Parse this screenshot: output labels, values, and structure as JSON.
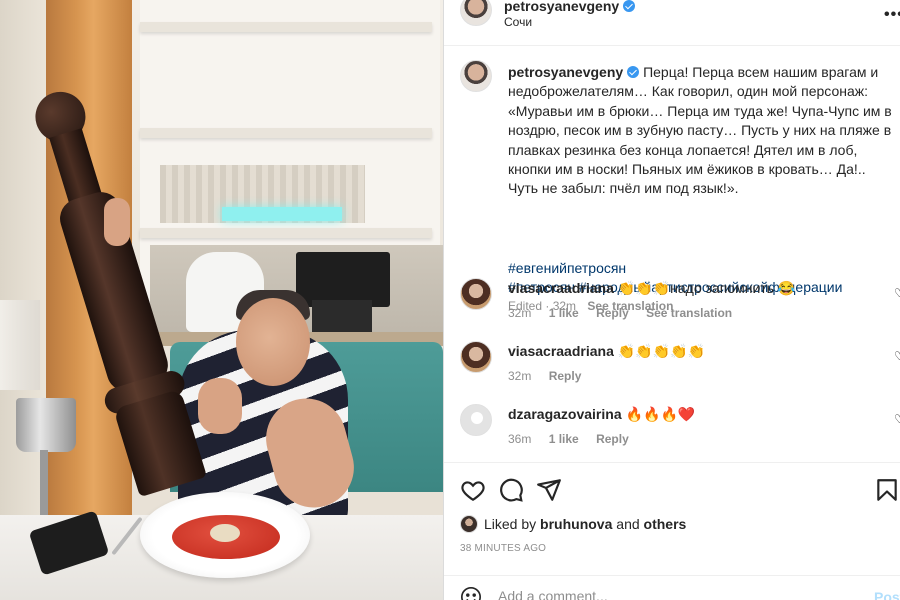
{
  "post": {
    "username": "petrosyanevgeny",
    "location": "Сочи",
    "caption_text": "Перца! Перца всем нашим врагам и недоброжелателям… Как говорил, один мой персонаж: «Муравьи им в брюки… Перца им туда же! Чупа-Чупс им в ноздрю, песок им в зубную пасту… Пусть у них на пляже в плавках резинка без конца лопается! Дятел им в лоб, кнопки им в носки! Пьяных им ёжиков в кровать… Да!.. Чуть не забыл: пчёл им под язык!».",
    "hashtags": [
      "#евгенийпетросян",
      "#петросян #народныйартистроссийскойфедерации"
    ],
    "edited_label": "Edited",
    "time": "32m",
    "see_translation": "See translation"
  },
  "comments": [
    {
      "username": "viasacraadriana",
      "text": "👏👏👏надо запомнить 😂",
      "time": "32m",
      "likes": "1 like",
      "reply": "Reply",
      "see_translation": "See translation"
    },
    {
      "username": "viasacraadriana",
      "text": "👏👏👏👏👏",
      "time": "32m",
      "likes": "",
      "reply": "Reply",
      "see_translation": ""
    },
    {
      "username": "dzaragazovairina",
      "text": "🔥🔥🔥❤️",
      "time": "36m",
      "likes": "1 like",
      "reply": "Reply",
      "see_translation": ""
    }
  ],
  "likes": {
    "prefix": "Liked by",
    "user": "bruhunova",
    "and": "and",
    "others": "others"
  },
  "timestamp": "38 MINUTES AGO",
  "comment_box": {
    "placeholder": "Add a comment...",
    "post_label": "Post"
  },
  "icons": {
    "more": "more-options-icon",
    "like": "heart-icon",
    "comment": "comment-icon",
    "share": "paper-plane-icon",
    "save": "bookmark-icon",
    "emoji": "emoji-icon",
    "verified": "verified-badge-icon"
  },
  "colors": {
    "link": "#00376b",
    "verified": "#3897f0",
    "muted": "#8e8e8e",
    "post_button": "#b2dffc"
  }
}
